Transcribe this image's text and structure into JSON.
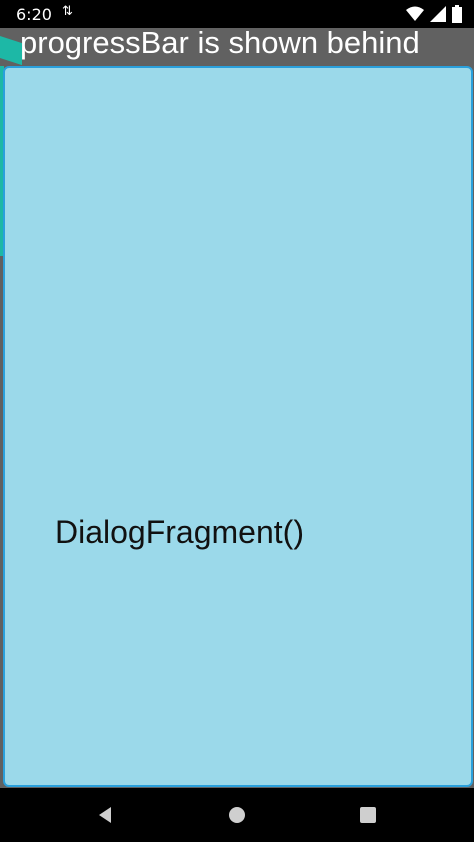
{
  "status_bar": {
    "time": "6:20",
    "data_icon": "data-transfer-icon",
    "icons": [
      "wifi-icon",
      "signal-icon",
      "battery-icon"
    ]
  },
  "app": {
    "title": "progressBar is shown behind",
    "background_color": "#616161",
    "accent_color": "#1db8a6"
  },
  "dialog": {
    "text": "DialogFragment()",
    "background_color": "#9bd9ea",
    "border_color": "#2aa0dc"
  },
  "nav_bar": {
    "buttons": [
      "back-icon",
      "home-icon",
      "recents-icon"
    ]
  }
}
